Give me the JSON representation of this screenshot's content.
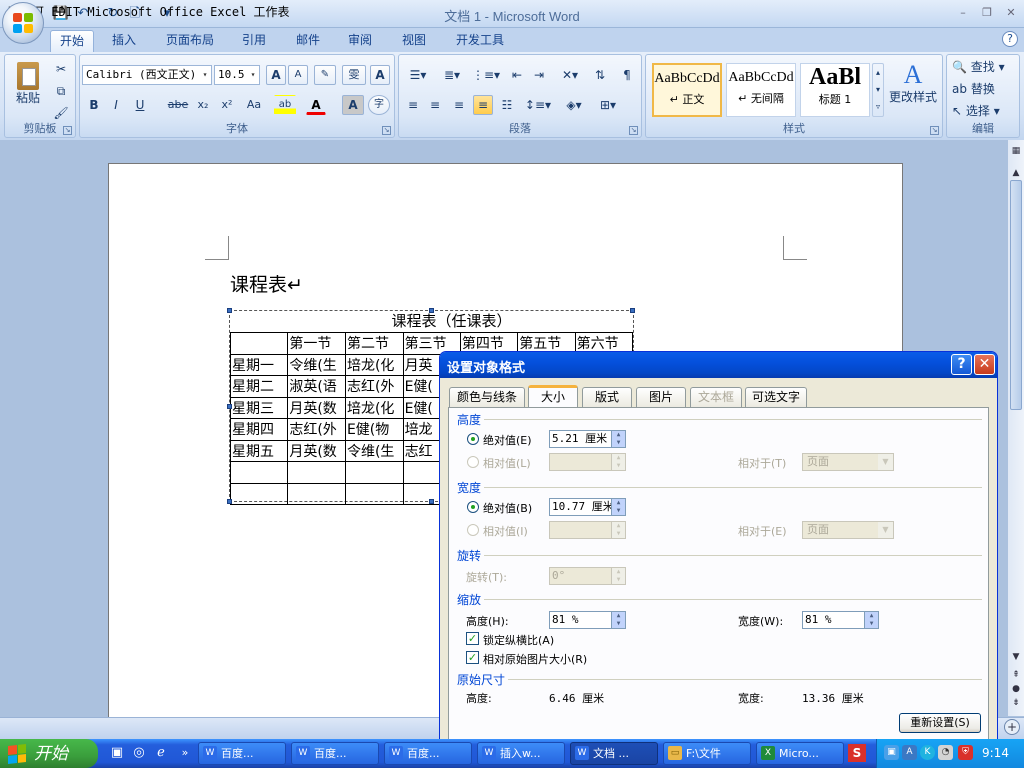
{
  "window": {
    "title": "文档 1 - Microsoft Word",
    "minimize": "–",
    "restore": "❐",
    "close": "✕"
  },
  "qat": {
    "save": "💾",
    "undo": "↶",
    "redo": "↻",
    "print": "🗋",
    "more": "▾"
  },
  "tabs": [
    "开始",
    "插入",
    "页面布局",
    "引用",
    "邮件",
    "审阅",
    "视图",
    "开发工具"
  ],
  "ribbon": {
    "clipboard": {
      "paste": "粘贴",
      "label": "剪贴板"
    },
    "font": {
      "name": "Calibri (西文正文)",
      "size": "10.5",
      "label": "字体",
      "bold": "B",
      "italic": "I",
      "underline": "U",
      "strike": "abe",
      "sub": "x₂",
      "sup": "x²",
      "case": "Aa",
      "grow": "A",
      "shrink": "A",
      "clear": "✎",
      "highlight": "ab",
      "color": "A",
      "shade": "A",
      "enclose": "字",
      "phonetic": "雯"
    },
    "paragraph": {
      "label": "段落"
    },
    "styles": {
      "label": "样式",
      "items": [
        {
          "sample": "AaBbCcDd",
          "name": "↵ 正文"
        },
        {
          "sample": "AaBbCcDd",
          "name": "↵ 无间隔"
        },
        {
          "sample": "AaBl",
          "name": "标题 1"
        }
      ],
      "change": "更改样式"
    },
    "editing": {
      "label": "编辑",
      "find": "查找",
      "replace": "替换",
      "select": "选择"
    }
  },
  "document": {
    "heading": "课程表↵",
    "table": {
      "caption": "课程表（任课表）",
      "headers": [
        "",
        "第一节",
        "第二节",
        "第三节",
        "第四节",
        "第五节",
        "第六节"
      ],
      "rows": [
        [
          "星期一",
          "令维(生",
          "培龙(化",
          "月英",
          "",
          "",
          ""
        ],
        [
          "星期二",
          "淑英(语",
          "志红(外",
          "E健(",
          "",
          "",
          ""
        ],
        [
          "星期三",
          "月英(数",
          "培龙(化",
          "E健(",
          "",
          "",
          ""
        ],
        [
          "星期四",
          "志红(外",
          "E健(物",
          "培龙",
          "",
          "",
          ""
        ],
        [
          "星期五",
          "月英(数",
          "令维(生",
          "志红",
          "",
          "",
          ""
        ],
        [
          "",
          "",
          "",
          "",
          "",
          "",
          ""
        ],
        [
          "",
          "",
          "",
          "",
          "",
          "",
          ""
        ]
      ]
    }
  },
  "dialog": {
    "title": "设置对象格式",
    "help": "?",
    "close": "✕",
    "tabs": [
      "颜色与线条",
      "大小",
      "版式",
      "图片",
      "文本框",
      "可选文字"
    ],
    "height": {
      "section": "高度",
      "absolute_label": "绝对值(E)",
      "absolute_value": "5.21 厘米",
      "relative_label": "相对值(L)",
      "relative_to_label": "相对于(T)",
      "relative_to_value": "页面"
    },
    "width": {
      "section": "宽度",
      "absolute_label": "绝对值(B)",
      "absolute_value": "10.77 厘米",
      "relative_label": "相对值(I)",
      "relative_to_label": "相对于(E)",
      "relative_to_value": "页面"
    },
    "rotation": {
      "section": "旋转",
      "label": "旋转(T):",
      "value": "0°"
    },
    "scale": {
      "section": "缩放",
      "height_label": "高度(H):",
      "height_value": "81 %",
      "width_label": "宽度(W):",
      "width_value": "81 %",
      "lock_label": "锁定纵横比(A)",
      "relative_label": "相对原始图片大小(R)"
    },
    "original": {
      "section": "原始尺寸",
      "height_label": "高度:",
      "height_value": "6.46 厘米",
      "width_label": "宽度:",
      "width_value": "13.36 厘米"
    },
    "reset": "重新设置(S)"
  },
  "status": "双击可 EDIT Microsoft Office Excel 工作表",
  "taskbar": {
    "start": "开始",
    "items": [
      "百度...",
      "百度...",
      "百度...",
      "插入w...",
      "文档 ...",
      "F:\\文件",
      "Micro..."
    ],
    "clock": "9:14"
  }
}
